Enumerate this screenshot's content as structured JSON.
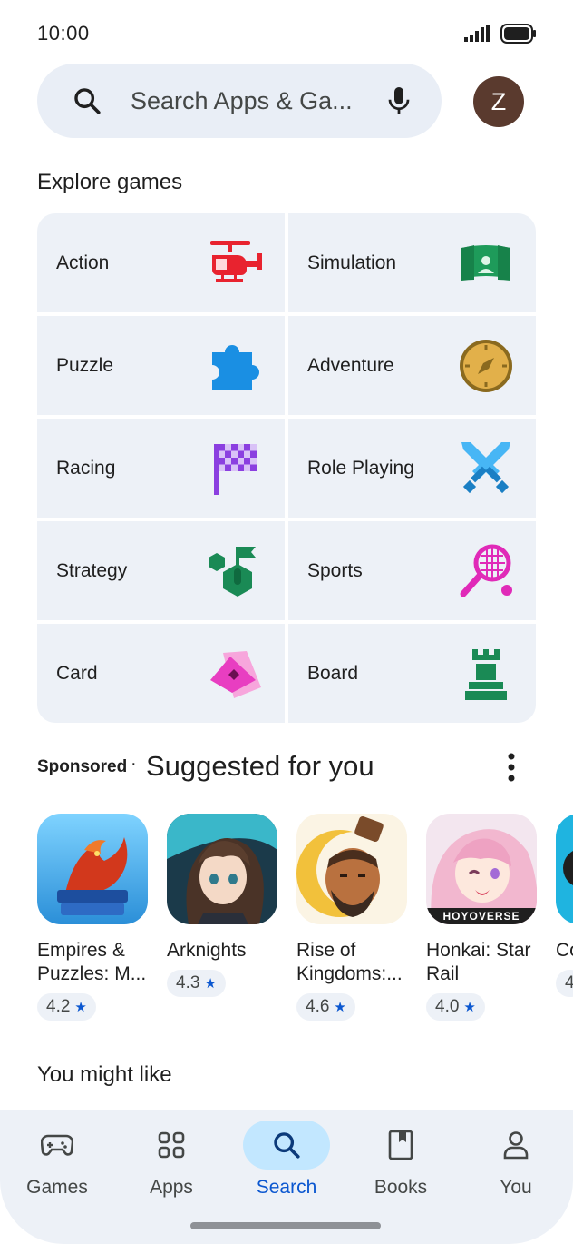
{
  "status_bar": {
    "time": "10:00"
  },
  "search": {
    "placeholder": "Search Apps & Ga...",
    "avatar_letter": "Z"
  },
  "explore": {
    "title": "Explore games",
    "categories": [
      {
        "label": "Action",
        "icon": "helicopter-icon"
      },
      {
        "label": "Simulation",
        "icon": "stage-icon"
      },
      {
        "label": "Puzzle",
        "icon": "puzzle-piece-icon"
      },
      {
        "label": "Adventure",
        "icon": "compass-icon"
      },
      {
        "label": "Racing",
        "icon": "checkered-flag-icon"
      },
      {
        "label": "Role Playing",
        "icon": "crossed-swords-icon"
      },
      {
        "label": "Strategy",
        "icon": "strategy-flag-icon"
      },
      {
        "label": "Sports",
        "icon": "tennis-racket-icon"
      },
      {
        "label": "Card",
        "icon": "cards-icon"
      },
      {
        "label": "Board",
        "icon": "chess-rook-icon"
      }
    ]
  },
  "suggested": {
    "sponsored_label": "Sponsored",
    "separator": "·",
    "title": "Suggested for you",
    "apps": [
      {
        "name": "Empires & Puzzles: M...",
        "rating": "4.2",
        "icon": "empires-puzzles-app-icon"
      },
      {
        "name": "Arknights",
        "rating": "4.3",
        "icon": "arknights-app-icon"
      },
      {
        "name": "Rise of Kingdoms:...",
        "rating": "4.6",
        "icon": "rise-of-kingdoms-app-icon"
      },
      {
        "name": "Honkai: Star Rail",
        "rating": "4.0",
        "icon": "honkai-star-rail-app-icon",
        "icon_caption": "HOYOVERSE"
      },
      {
        "name": "Co",
        "rating": "4",
        "icon": "partial-app-icon"
      }
    ]
  },
  "you_might_like": {
    "title": "You might like"
  },
  "bottom_nav": {
    "items": [
      {
        "label": "Games",
        "icon": "gamepad-icon",
        "active": false
      },
      {
        "label": "Apps",
        "icon": "apps-grid-icon",
        "active": false
      },
      {
        "label": "Search",
        "icon": "search-icon",
        "active": true
      },
      {
        "label": "Books",
        "icon": "book-icon",
        "active": false
      },
      {
        "label": "You",
        "icon": "person-icon",
        "active": false
      }
    ]
  },
  "colors": {
    "accent": "#0b57d0",
    "active_pill": "#c2e7ff",
    "surface": "#edf1f7"
  }
}
